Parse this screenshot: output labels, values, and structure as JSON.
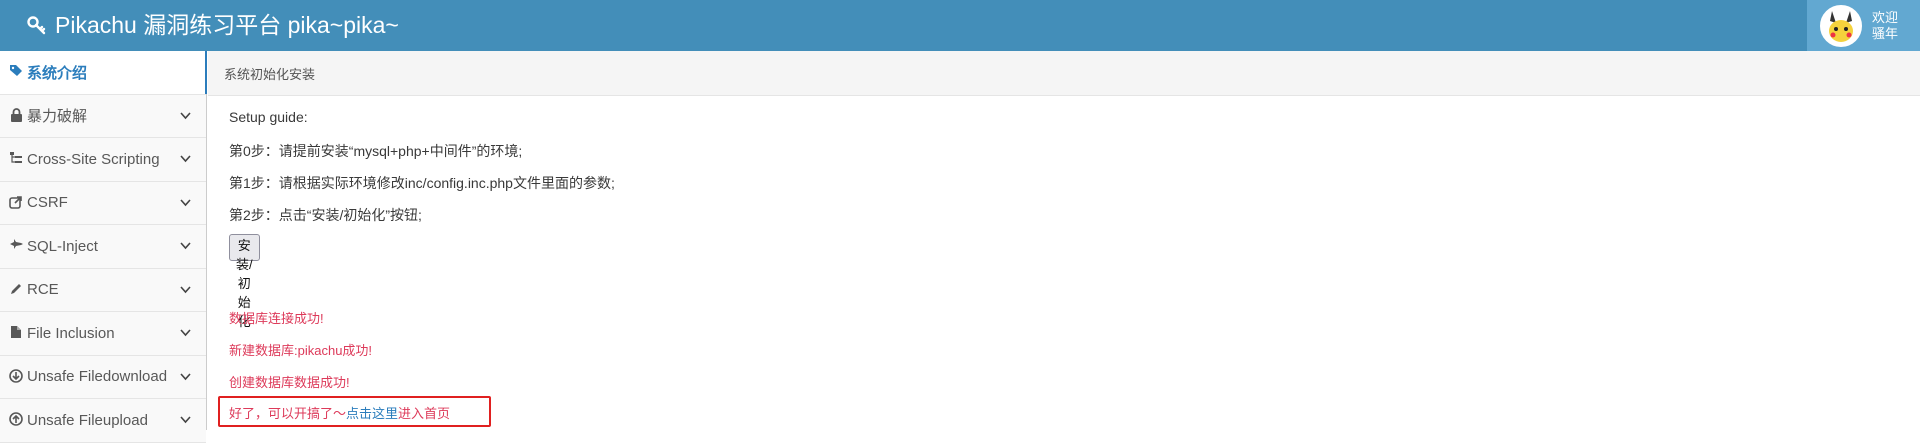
{
  "header": {
    "title": "Pikachu 漏洞练习平台 pika~pika~",
    "brand_icon": "key-icon",
    "welcome_line1": "欢迎",
    "welcome_line2": "骚年",
    "accent": "#438eb9"
  },
  "sidebar": {
    "items": [
      {
        "label": "系统介绍",
        "icon": "tags-icon"
      },
      {
        "label": "暴力破解",
        "icon": "lock-icon"
      },
      {
        "label": "Cross-Site Scripting",
        "icon": "sitemap-icon"
      },
      {
        "label": "CSRF",
        "icon": "share-icon"
      },
      {
        "label": "SQL-Inject",
        "icon": "fighter-jet-icon"
      },
      {
        "label": "RCE",
        "icon": "pencil-icon"
      },
      {
        "label": "File Inclusion",
        "icon": "file-icon"
      },
      {
        "label": "Unsafe Filedownload",
        "icon": "download-icon"
      },
      {
        "label": "Unsafe Fileupload",
        "icon": "upload-icon"
      }
    ]
  },
  "breadcrumb": "系统初始化安装",
  "main": {
    "guide_title": "Setup guide:",
    "step0": "第0步：请提前安装“mysql+php+中间件”的环境;",
    "step1": "第1步：请根据实际环境修改inc/config.inc.php文件里面的参数;",
    "step2": "第2步：点击“安装/初始化”按钮;",
    "install_button": "安装/初始化",
    "msg_db_connect": "数据库连接成功!",
    "msg_new_db": "新建数据库:pikachu成功!",
    "msg_create_data": "创建数据库数据成功!",
    "final_prefix": "好了，可以开搞了～",
    "final_link": "点击这里",
    "final_suffix": "进入首页"
  }
}
